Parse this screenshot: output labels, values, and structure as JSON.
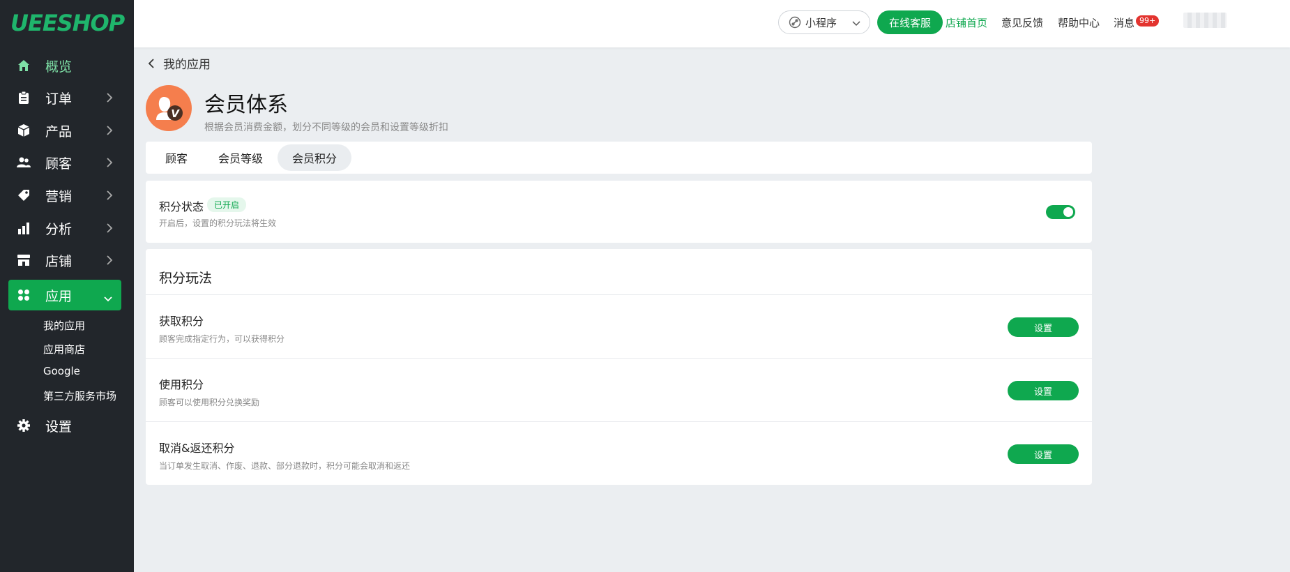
{
  "brand": {
    "logo_text": "UEESHOP",
    "accent_color": "#0fa84f"
  },
  "sidebar": {
    "items": [
      {
        "label": "概览",
        "icon": "home-icon"
      },
      {
        "label": "订单",
        "icon": "clipboard-icon"
      },
      {
        "label": "产品",
        "icon": "box-icon"
      },
      {
        "label": "顾客",
        "icon": "users-icon"
      },
      {
        "label": "营销",
        "icon": "tag-icon"
      },
      {
        "label": "分析",
        "icon": "bar-chart-icon"
      },
      {
        "label": "店铺",
        "icon": "store-icon"
      },
      {
        "label": "应用",
        "icon": "apps-icon"
      }
    ],
    "sub_items": [
      "我的应用",
      "应用商店",
      "Google",
      "第三方服务市场"
    ],
    "settings_label": "设置"
  },
  "topbar": {
    "mini_program_label": "小程序",
    "service_button": "在线客服",
    "links": [
      "店铺首页",
      "意见反馈",
      "帮助中心",
      "消息"
    ],
    "message_badge": "99+"
  },
  "page": {
    "back_label": "我的应用",
    "title": "会员体系",
    "description": "根据会员消费金额，划分不同等级的会员和设置等级折扣",
    "tabs": [
      "顾客",
      "会员等级",
      "会员积分"
    ],
    "active_tab": "会员积分"
  },
  "points_status": {
    "title": "积分状态",
    "badge": "已开启",
    "description": "开启后，设置的积分玩法将生效",
    "enabled": true
  },
  "points_play": {
    "section_title": "积分玩法",
    "rows": [
      {
        "title": "获取积分",
        "description": "顾客完成指定行为，可以获得积分",
        "button": "设置"
      },
      {
        "title": "使用积分",
        "description": "顾客可以使用积分兑换奖励",
        "button": "设置"
      },
      {
        "title": "取消&返还积分",
        "description": "当订单发生取消、作废、退款、部分退款时，积分可能会取消和返还",
        "button": "设置"
      }
    ]
  }
}
